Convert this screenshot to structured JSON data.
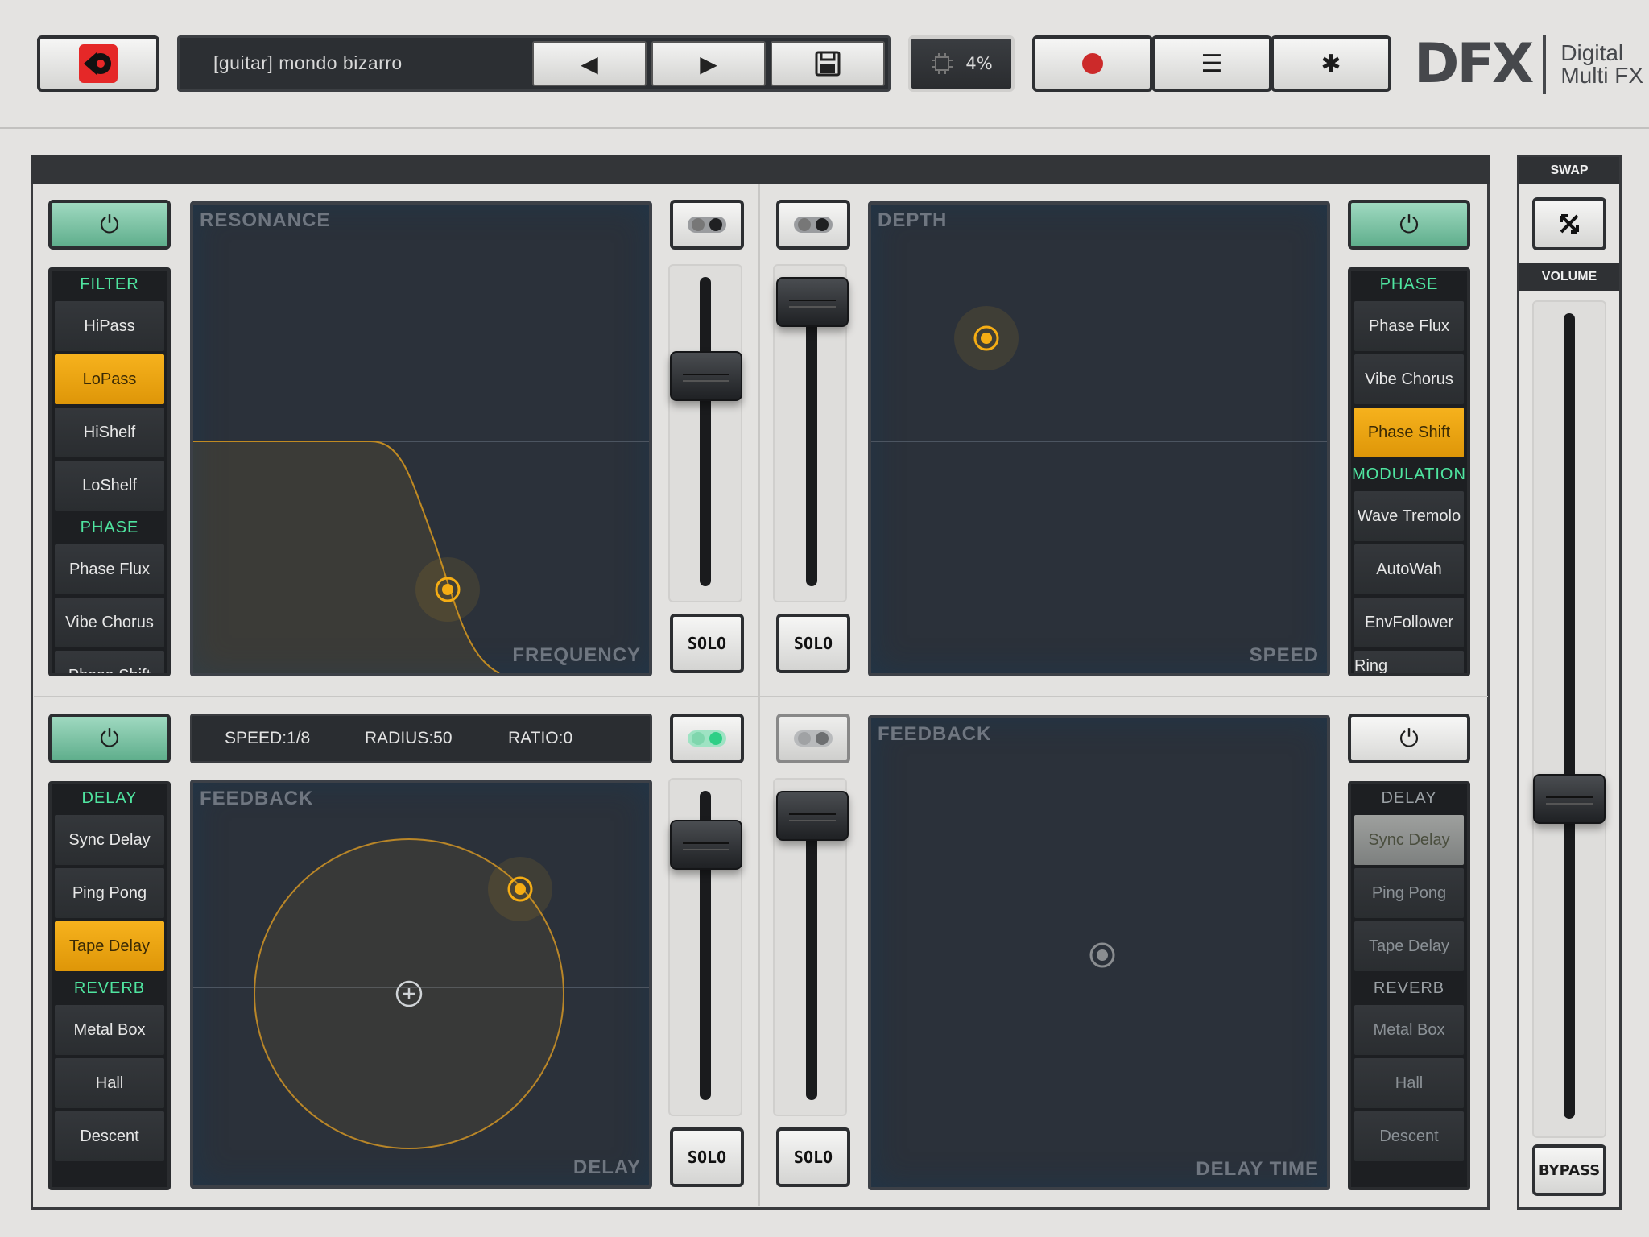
{
  "header": {
    "preset_name": "[guitar] mondo bizarro",
    "cpu_label": "4%",
    "logo_main": "DFX",
    "logo_sub1": "Digital",
    "logo_sub2": "Multi FX"
  },
  "icons": {
    "app": "app-logo-icon",
    "prev": "◀",
    "next": "▶",
    "save": "floppy-disk-icon",
    "record": "●",
    "menu": "☰",
    "settings": "✱",
    "power": "⏻"
  },
  "colors": {
    "accent_orange": "#f5ad14",
    "accent_green": "#4fe5a0",
    "app_red": "#e52828",
    "record_red": "#cc2a2a"
  },
  "quad_tl": {
    "category1": "FILTER",
    "items": [
      "HiPass",
      "LoPass",
      "HiShelf",
      "LoShelf"
    ],
    "category2": "PHASE",
    "items2": [
      "Phase Flux",
      "Vibe Chorus",
      "Phase Shift"
    ],
    "pad_y": "RESONANCE",
    "pad_x": "FREQUENCY",
    "power": "on"
  },
  "quad_tr": {
    "category1": "PHASE",
    "items": [
      "Phase Flux",
      "Vibe Chorus",
      "Phase Shift"
    ],
    "category2": "MODULATION",
    "items2": [
      "Wave Tremolo",
      "AutoWah",
      "EnvFollower",
      "Ring Modulation"
    ],
    "pad_y": "DEPTH",
    "pad_x": "SPEED",
    "power": "on"
  },
  "quad_bl": {
    "category1": "DELAY",
    "items": [
      "Sync Delay",
      "Ping Pong",
      "Tape Delay"
    ],
    "category2": "REVERB",
    "items2": [
      "Metal Box",
      "Hall",
      "Descent"
    ],
    "pad_y": "FEEDBACK",
    "pad_x": "DELAY",
    "info": {
      "speed": "SPEED:1/8",
      "radius": "RADIUS:50",
      "ratio": "RATIO:0"
    },
    "power": "on"
  },
  "quad_br": {
    "category1": "DELAY",
    "items": [
      "Sync Delay",
      "Ping Pong",
      "Tape Delay"
    ],
    "category2": "REVERB",
    "items2": [
      "Metal Box",
      "Hall",
      "Descent"
    ],
    "pad_y": "FEEDBACK",
    "pad_x": "DELAY TIME",
    "power": "off"
  },
  "solo_label": "SOLO",
  "side": {
    "swap": "SWAP",
    "volume": "VOLUME",
    "bypass": "BYPASS"
  }
}
